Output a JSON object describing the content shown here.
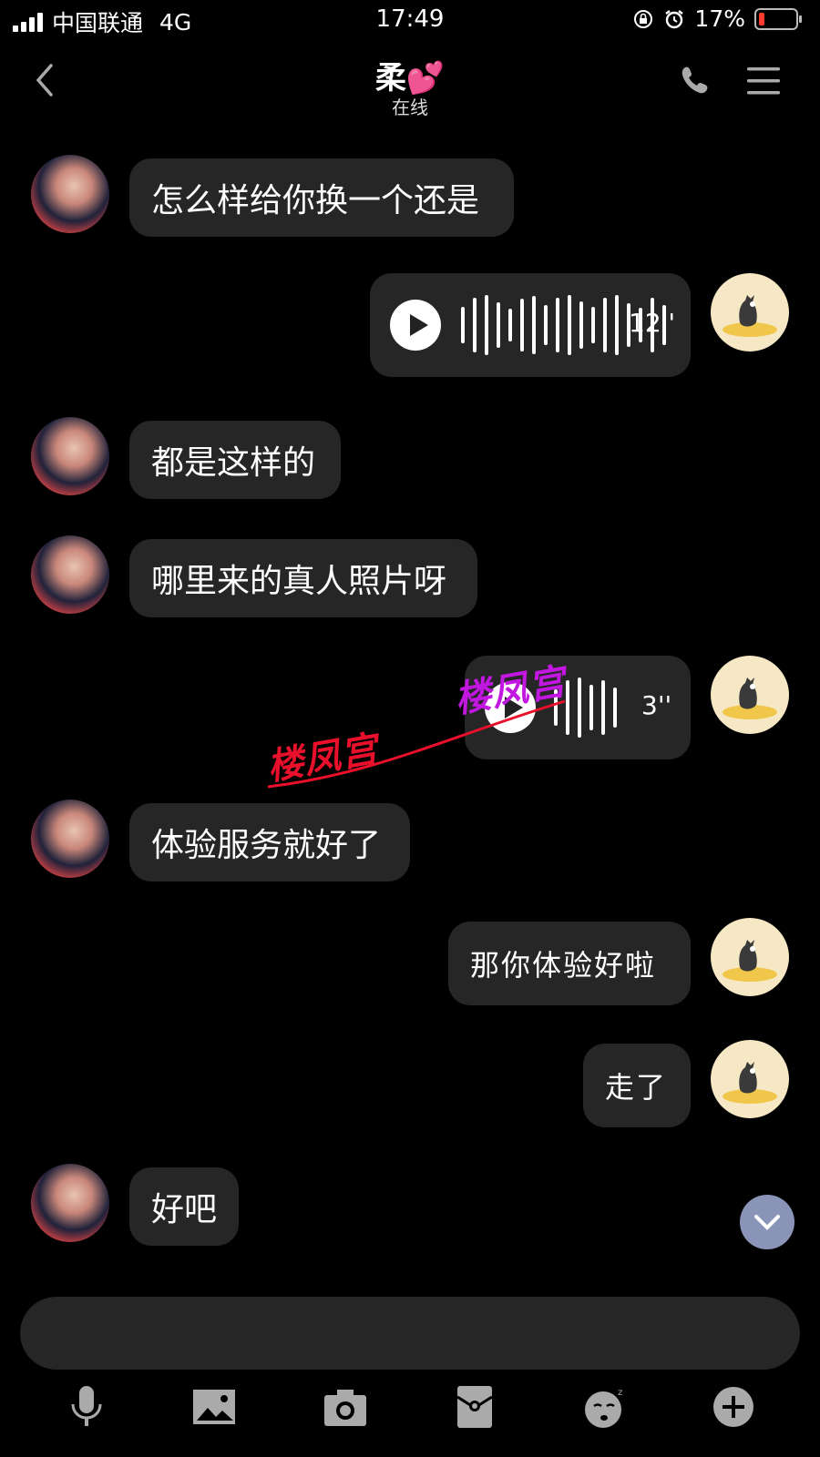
{
  "status_bar": {
    "carrier": "中国联通",
    "network": "4G",
    "time": "17:49",
    "battery": "17%"
  },
  "header": {
    "title": "柔💕",
    "subtitle": "在线"
  },
  "messages": [
    {
      "side": "them",
      "type": "text",
      "text": "怎么样给你换一个还是"
    },
    {
      "side": "me",
      "type": "voice",
      "duration": "12''"
    },
    {
      "side": "them",
      "type": "text",
      "text": "都是这样的"
    },
    {
      "side": "them",
      "type": "text",
      "text": "哪里来的真人照片呀"
    },
    {
      "side": "me",
      "type": "voice",
      "duration": "3''"
    },
    {
      "side": "them",
      "type": "text",
      "text": "体验服务就好了"
    },
    {
      "side": "me",
      "type": "text",
      "text": "那你体验好啦"
    },
    {
      "side": "me",
      "type": "text",
      "text": "走了"
    },
    {
      "side": "them",
      "type": "text",
      "text": "好吧"
    }
  ],
  "watermarks": [
    "楼凤宫",
    "楼凤宫"
  ],
  "colors": {
    "bubble": "#262626",
    "background": "#000000",
    "watermark_red": "#e8102a",
    "watermark_purple": "#c217e0"
  },
  "toolbar": [
    "microphone-icon",
    "image-icon",
    "camera-icon",
    "red-packet-icon",
    "emoji-icon",
    "plus-icon"
  ]
}
